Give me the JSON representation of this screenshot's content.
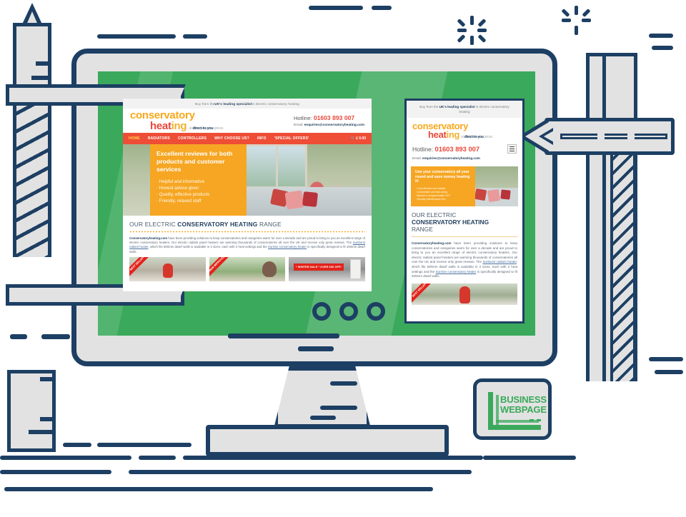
{
  "colors": {
    "navy": "#1d3f63",
    "screen_green": "#3aa95b",
    "nav_red": "#ee4d36",
    "promo_orange": "#f6a623",
    "logo_yellow": "#f7a81b",
    "logo_red": "#e8483a",
    "badge_green": "#3aa95b",
    "ribbon_red": "#e2231a",
    "frame_grey": "#e2e2e2"
  },
  "desktop_site": {
    "top_strip": {
      "pre": "Buy from the ",
      "bold": "UK's leading specialist",
      "post": " in electric conservatory heating"
    },
    "logo": {
      "line1": "conservatory",
      "line2_a": "heat",
      "line2_b": "ing",
      "tagline_pre": "at ",
      "tagline_bold": "direct-to-you",
      "tagline_post": " prices"
    },
    "contact": {
      "hotline_label": "Hotline:",
      "hotline_number": "01603 893 007",
      "email_label": "Email:",
      "email_address": "enquiries@conservatoryheating.com"
    },
    "nav": {
      "items": [
        {
          "label": "HOME",
          "active": true
        },
        {
          "label": "RADIATORS",
          "active": false
        },
        {
          "label": "CONTROLLERS",
          "active": false
        },
        {
          "label": "WHY CHOOSE US?",
          "active": false
        },
        {
          "label": "INFO",
          "active": false
        },
        {
          "label": "'SPECIAL OFFERS'",
          "active": false
        }
      ],
      "cart": "£ 0.00",
      "cart_icon": "shopping-cart-icon"
    },
    "hero": {
      "heading": "Excellent reviews for both products and customer services",
      "bullets": [
        "Helpful and informative",
        "Honest advice given",
        "Quality, effective products",
        "Friendly, relaxed staff"
      ]
    },
    "range": {
      "heading_pre": "OUR ELECTRIC ",
      "heading_bold": "CONSERVATORY HEATING",
      "heading_post": " RANGE",
      "body_1": "Conservatoryheating.com",
      "body_2": " have been providing solutions to keep conservatories and orangeries warm for over a decade and are proud to bring to you an excellent range of electric conservatory heaters. Our electric radiant panel heaters are warming thousands of conservatories all over the UK and receive only great reviews. The ",
      "link_1": "Sunburst radiant heater",
      "body_3": ", which fits 600mm dwarf walls is available in 3 sizes, each with 2 heat settings and the ",
      "link_2": "Sunrise conservatory heater",
      "body_4": " is specifically designed to fit 400mm dwarf walls."
    },
    "tiles": [
      {
        "ribbon": "BEST SELLER",
        "name": "product-tile-best-seller"
      },
      {
        "ribbon": "NEW IMPROVED",
        "name": "product-tile-new-improved"
      },
      {
        "ribbon": "* WINTER SALE * OVER £60 OFF!",
        "name": "product-tile-winter-sale"
      }
    ]
  },
  "mobile_site": {
    "top_strip": {
      "pre": "Buy from the ",
      "bold": "UK's leading specialist",
      "post": " in electric conservatory heating"
    },
    "logo": {
      "line1": "conservatory",
      "line2_a": "heat",
      "line2_b": "ing",
      "tagline_pre": "at ",
      "tagline_bold": "direct-to-you",
      "tagline_post": " prices"
    },
    "contact": {
      "hotline_label": "Hotline:",
      "hotline_number": "01603 893 007",
      "email_label": "Email:",
      "email_address": "enquiries@conservatoryheating.com"
    },
    "menu_icon": "hamburger-menu-icon",
    "hero": {
      "heading": "Use your conservatory all year round and save money heating it!",
      "bullets": [
        "Cost effective and reliable",
        "Comfortable and fast acting",
        "Manual or programmable 24/7",
        "Virtually maintenance free"
      ]
    },
    "range": {
      "heading_pre": "OUR ELECTRIC",
      "heading_bold": "CONSERVATORY HEATING",
      "heading_post": "RANGE",
      "body_1": "Conservatoryheating.com",
      "body_2": " have been providing solutions to keep conservatories and orangeries warm for over a decade and are proud to bring to you an excellent range of electric conservatory heaters. Our electric radiant panel heaters are warming thousands of conservatories all over the UK and receive only great reviews. The ",
      "link_1": "Sunburst radiant heater",
      "body_3": ", which fits 600mm dwarf walls is available in 3 sizes, each with 2 heat settings and the ",
      "link_2": "Sunrise conservatory heater",
      "body_4": " is specifically designed to fit 400mm dwarf walls."
    },
    "tile": {
      "ribbon": "BEST SELLER"
    }
  },
  "badge": {
    "line1": "BUSINESS",
    "line2": "WEBPAGE",
    "icon": "document-corner-icon"
  },
  "illustration": {
    "arrow": "left-pointing-arrow-sign",
    "tower": "hatched-crane-tower",
    "mast": "surveyor-mast",
    "monitor": "desktop-monitor"
  }
}
